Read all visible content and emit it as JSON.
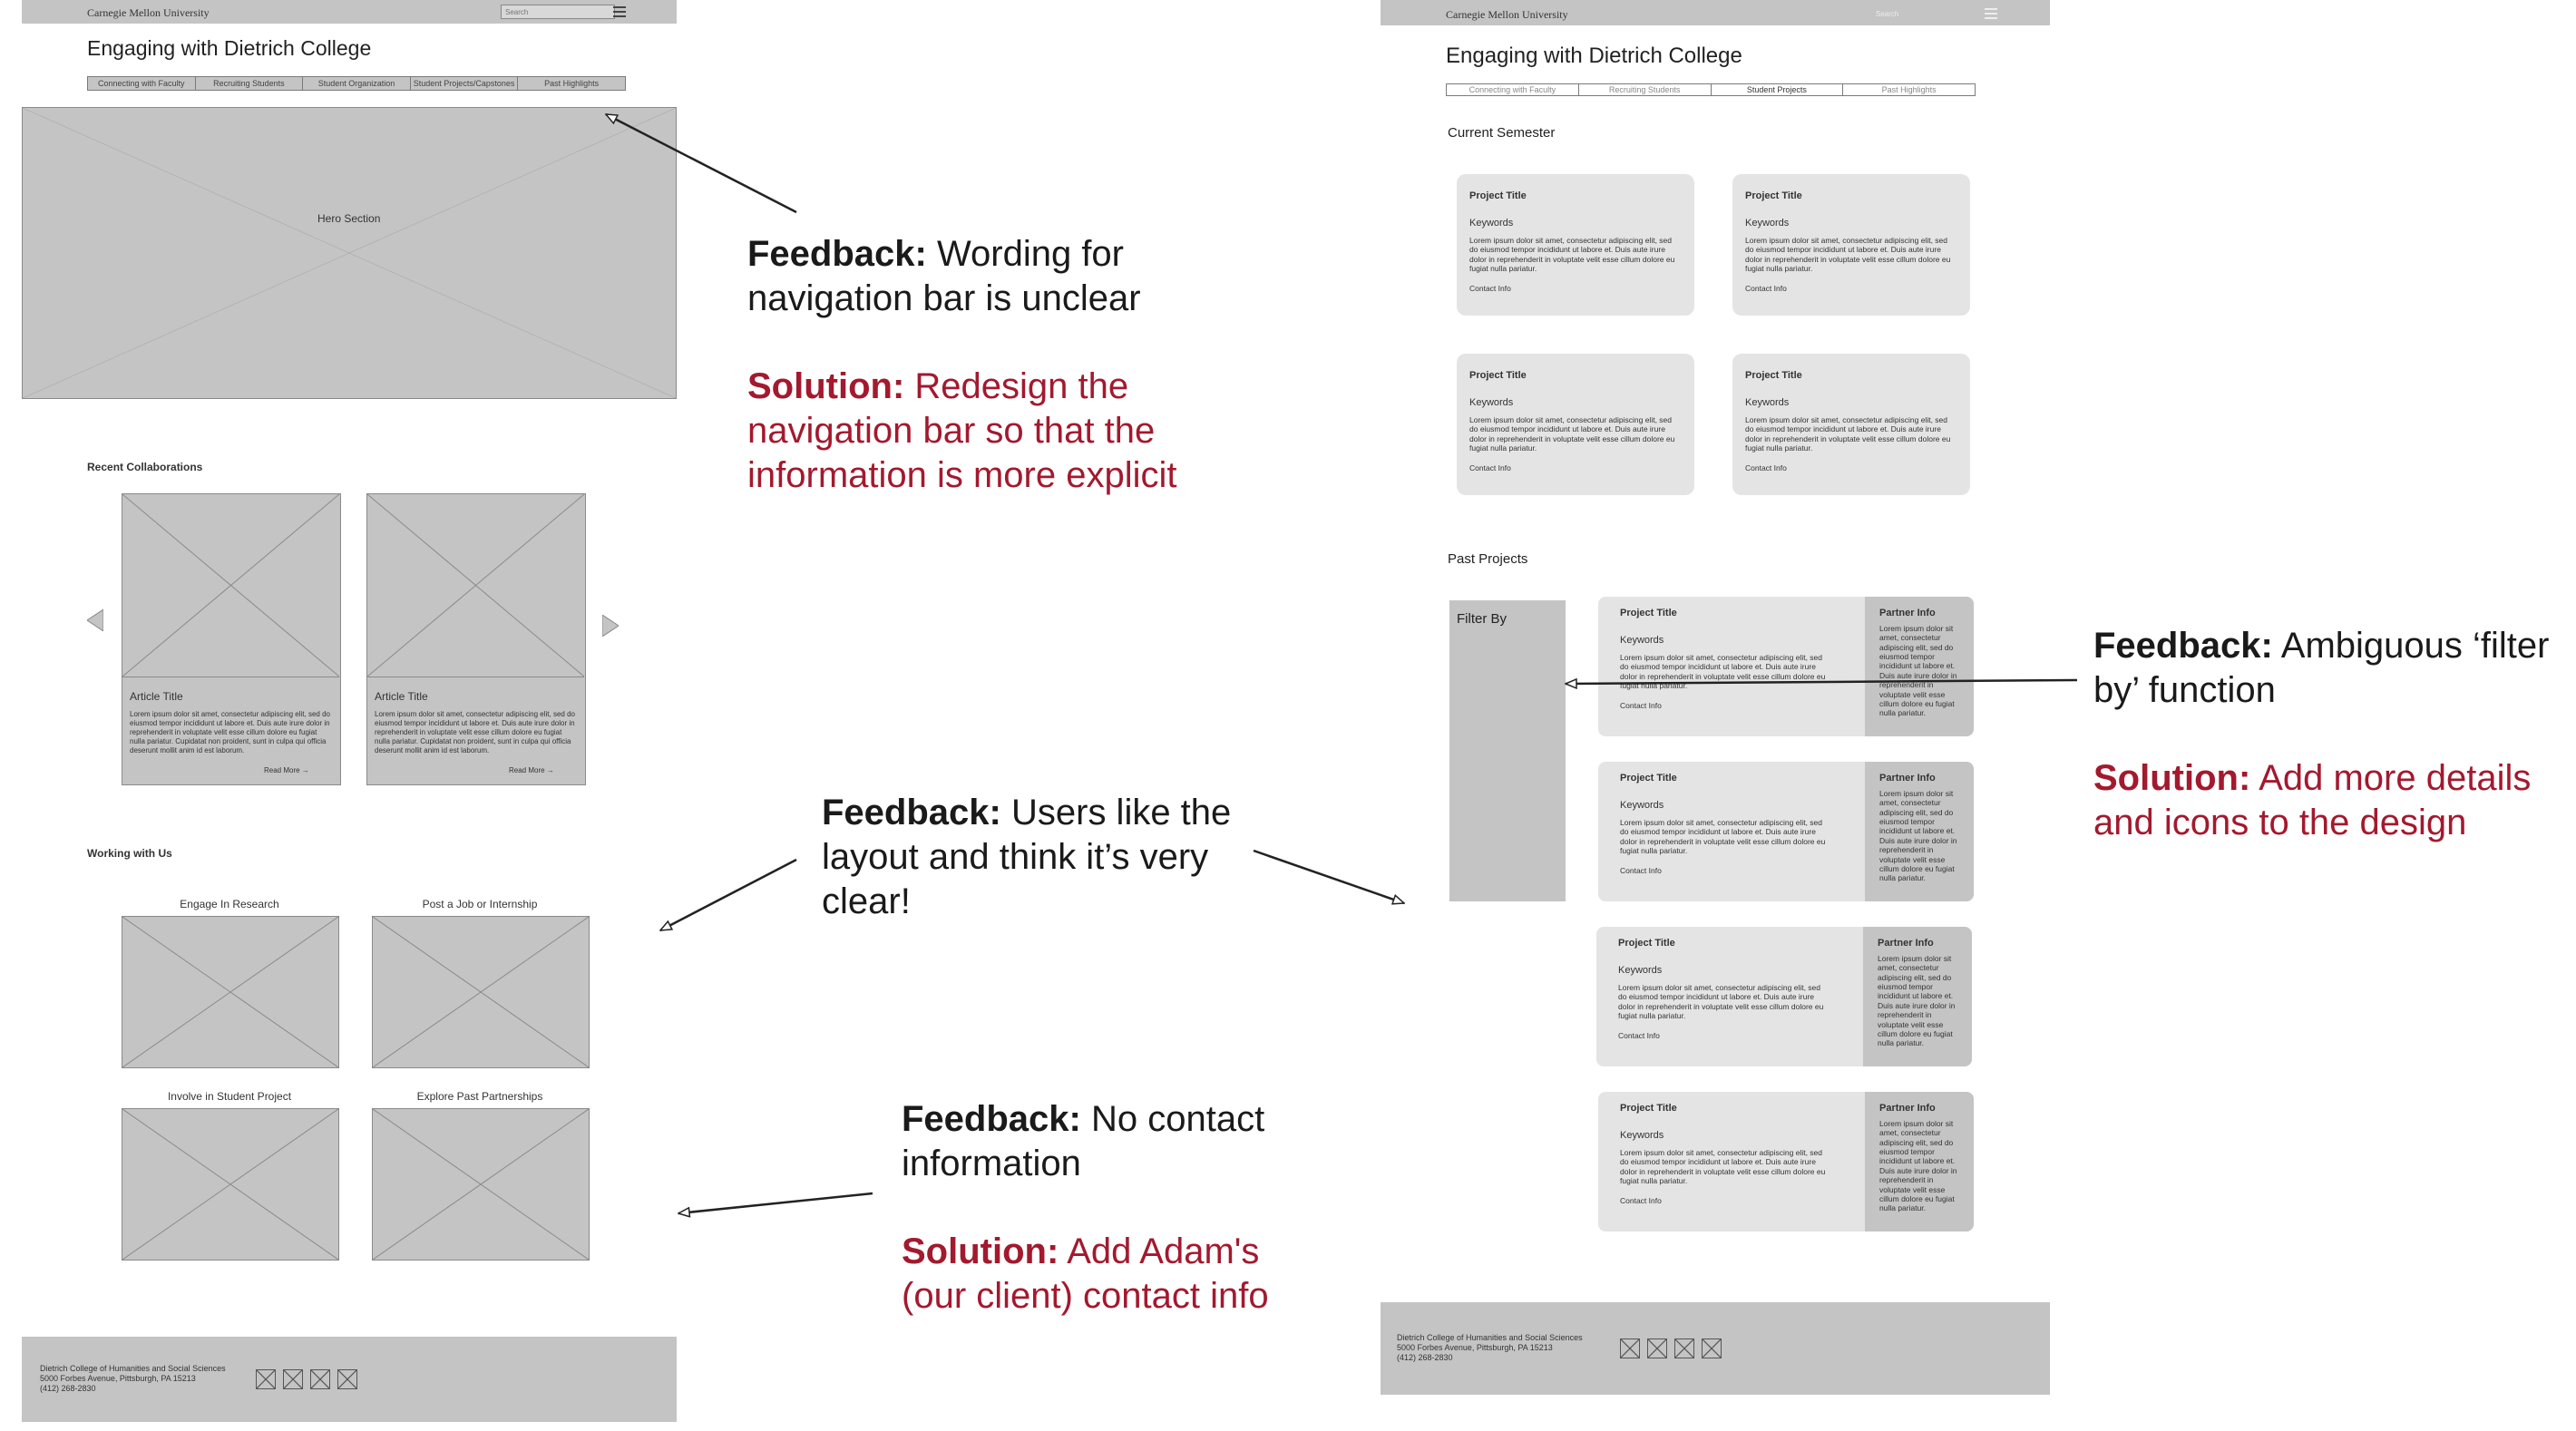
{
  "left": {
    "topbar_brand": "Carnegie Mellon University",
    "search_placeholder": "Search",
    "page_title": "Engaging with Dietrich College",
    "nav": [
      "Connecting with Faculty",
      "Recruiting Students",
      "Student Organization",
      "Student Projects/Capstones",
      "Past Highlights"
    ],
    "hero_label": "Hero Section",
    "recent_heading": "Recent Collaborations",
    "articles": [
      {
        "title": "Article Title",
        "body": "Lorem ipsum dolor sit amet, consectetur adipiscing elit, sed do eiusmod tempor incididunt ut labore et. Duis aute irure dolor in reprehenderit in voluptate velit esse cillum dolore eu fugiat nulla pariatur. Cupidatat non proident, sunt in culpa qui officia deserunt mollit anim id est laborum.",
        "link": "Read More →"
      },
      {
        "title": "Article Title",
        "body": "Lorem ipsum dolor sit amet, consectetur adipiscing elit, sed do eiusmod tempor incididunt ut labore et. Duis aute irure dolor in reprehenderit in voluptate velit esse cillum dolore eu fugiat nulla pariatur. Cupidatat non proident, sunt in culpa qui officia deserunt mollit anim id est laborum.",
        "link": "Read More →"
      }
    ],
    "working_heading": "Working with Us",
    "tiles": [
      "Engage In Research",
      "Post a Job or Internship",
      "Involve in Student Project",
      "Explore Past Partnerships"
    ],
    "footer_lines": [
      "Dietrich College of Humanities and Social Sciences",
      "5000 Forbes Avenue, Pittsburgh, PA 15213",
      "(412) 268-2830"
    ]
  },
  "right": {
    "topbar_brand": "Carnegie Mellon University",
    "search_placeholder": "Search",
    "page_title": "Engaging with Dietrich College",
    "nav": [
      "Connecting with Faculty",
      "Recruiting Students",
      "Student Projects",
      "Past Highlights"
    ],
    "current_heading": "Current Semester",
    "card": {
      "title": "Project Title",
      "keywords": "Keywords",
      "body": "Lorem ipsum dolor sit amet, consectetur adipiscing elit, sed do eiusmod tempor incididunt ut labore et. Duis aute irure dolor in reprehenderit in voluptate velit esse cillum dolore eu fugiat nulla pariatur.",
      "contact": "Contact Info"
    },
    "past_heading": "Past Projects",
    "filter_label": "Filter By",
    "partner_title": "Partner Info",
    "partner_body": "Lorem ipsum dolor sit amet, consectetur adipiscing elit, sed do eiusmod tempor incididunt ut labore et. Duis aute irure dolor in reprehenderit in voluptate velit esse cillum dolore eu fugiat nulla pariatur.",
    "footer_lines": [
      "Dietrich College of Humanities and Social Sciences",
      "5000 Forbes Avenue, Pittsburgh, PA 15213",
      "(412) 268-2830"
    ]
  },
  "annotations": {
    "nav": {
      "fb_label": "Feedback:",
      "fb_text": "Wording for navigation bar is unclear",
      "sol_label": "Solution:",
      "sol_text": "Redesign the navigation bar so that the information is more explicit"
    },
    "layout": {
      "fb_label": "Feedback:",
      "fb_text": "Users like the layout and think it’s very clear!"
    },
    "contact": {
      "fb_label": "Feedback:",
      "fb_text": "No contact information",
      "sol_label": "Solution:",
      "sol_text": "Add Adam's (our client) contact info"
    },
    "filter": {
      "fb_label": "Feedback:",
      "fb_text": "Ambiguous ‘filter by’ function",
      "sol_label": "Solution:",
      "sol_text": "Add more details and icons to the design"
    }
  },
  "colors": {
    "wire_gray": "#c4c4c4",
    "card_gray": "#e4e4e4",
    "solution_red": "#a3192e"
  }
}
